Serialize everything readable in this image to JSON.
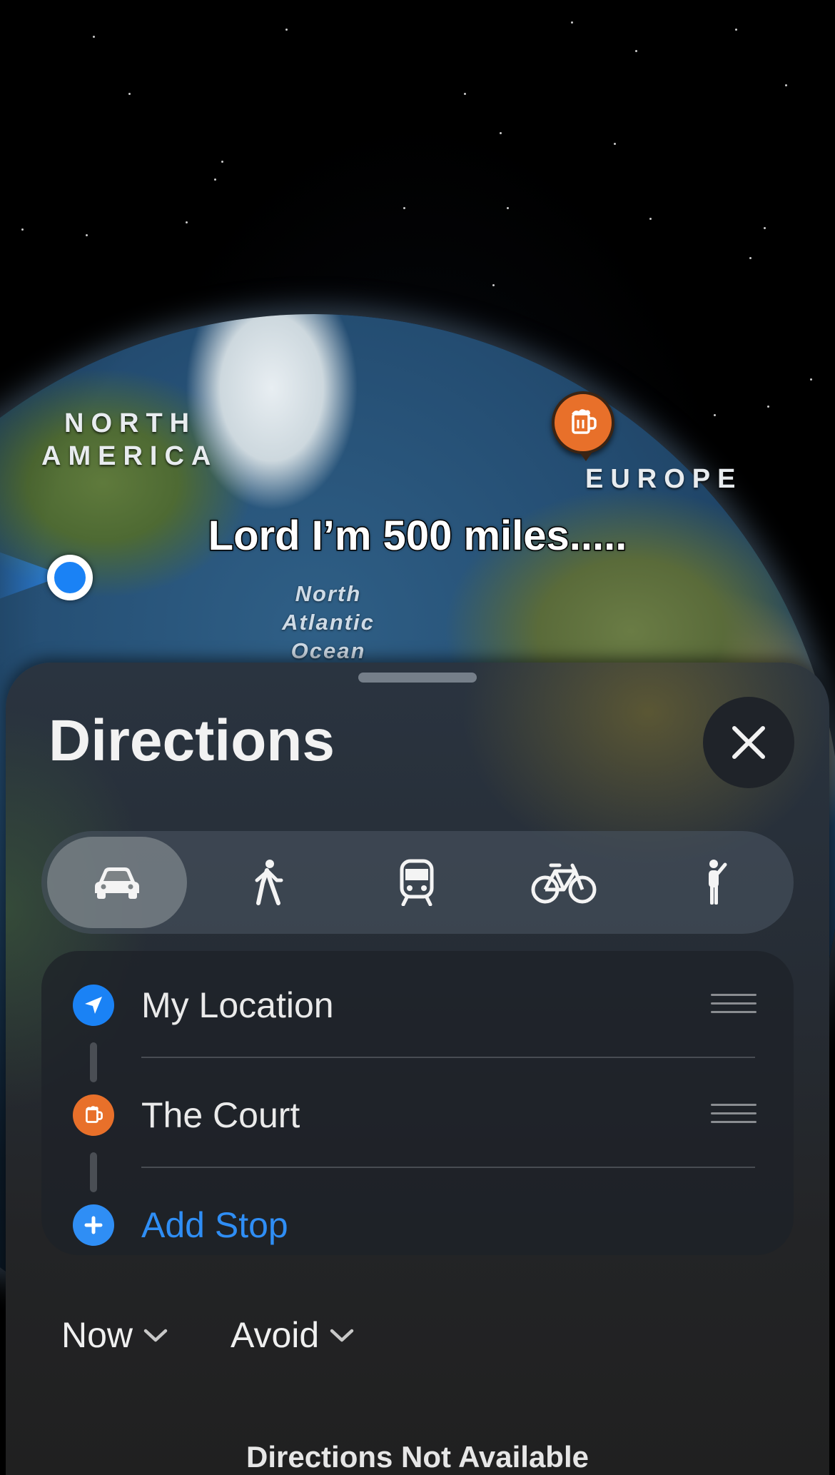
{
  "map": {
    "continent_labels": {
      "north_america_line1": "NORTH",
      "north_america_line2": "AMERICA",
      "europe": "EUROPE"
    },
    "ocean_label": {
      "line1": "North",
      "line2": "Atlantic",
      "line3": "Ocean"
    },
    "poi_icon": "beer-mug-icon",
    "user_location_icon": "location-dot-icon"
  },
  "caption": "Lord I’m 500 miles.....",
  "sheet": {
    "title": "Directions",
    "close_icon": "close-icon",
    "transport_modes": [
      {
        "icon": "car-icon",
        "selected": true
      },
      {
        "icon": "walk-icon",
        "selected": false
      },
      {
        "icon": "transit-icon",
        "selected": false
      },
      {
        "icon": "bicycle-icon",
        "selected": false
      },
      {
        "icon": "rideshare-icon",
        "selected": false
      }
    ],
    "stops": [
      {
        "label": "My Location",
        "icon": "navigation-arrow-icon",
        "color": "#1a82f5"
      },
      {
        "label": "The Court",
        "icon": "beer-mug-icon",
        "color": "#e8702a"
      }
    ],
    "add_stop_label": "Add Stop",
    "add_stop_color": "#2f8ef5",
    "options": {
      "time_label": "Now",
      "avoid_label": "Avoid"
    },
    "status_text": "Directions Not Available"
  }
}
